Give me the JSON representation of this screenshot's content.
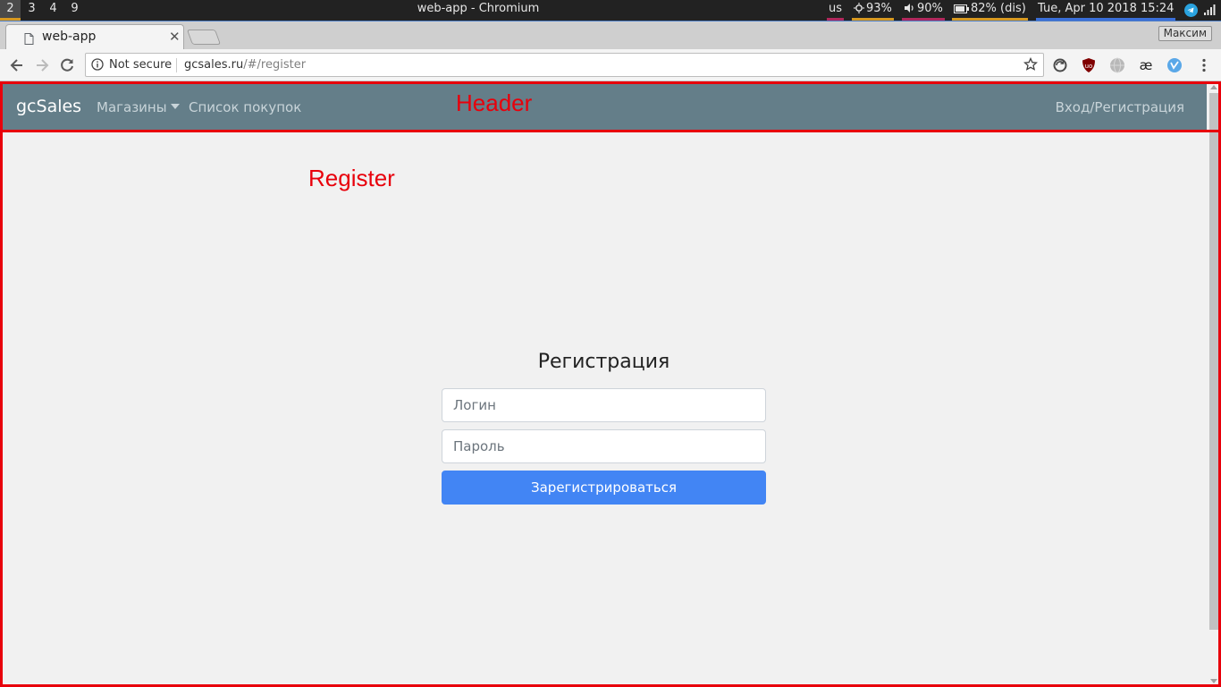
{
  "system_bar": {
    "workspaces": [
      "2",
      "3",
      "4",
      "9"
    ],
    "active_workspace": "2",
    "window_title": "web-app - Chromium",
    "keyboard_layout": "us",
    "brightness": "93%",
    "volume": "90%",
    "battery": "82% (dis)",
    "datetime": "Tue, Apr 10 2018 15:24"
  },
  "browser": {
    "tab_title": "web-app",
    "profile_name": "Максим",
    "security_label": "Not secure",
    "url_host": "gcsales.ru",
    "url_path": "/#/register"
  },
  "navbar": {
    "brand": "gcSales",
    "stores": "Магазины",
    "shopping_list": "Список покупок",
    "login_register": "Вход/Регистрация"
  },
  "register_form": {
    "title": "Регистрация",
    "login_placeholder": "Логин",
    "password_placeholder": "Пароль",
    "submit_label": "Зарегистрироваться"
  },
  "annotations": {
    "header_label": "Header",
    "register_label": "Register",
    "color": "#e8000b"
  },
  "colors": {
    "navbar": "#647e89",
    "primary_button": "#4285f4",
    "page_bg": "#f1f1f1"
  }
}
